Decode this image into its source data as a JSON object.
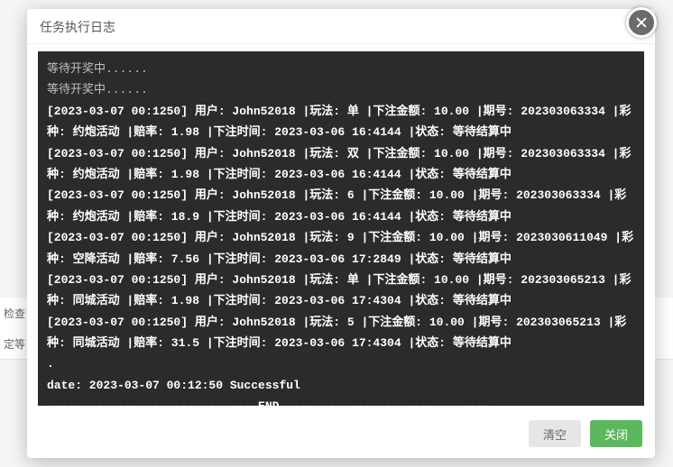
{
  "background_rows": [
    "检查",
    "定等"
  ],
  "modal": {
    "title": "任务执行日志",
    "clear_label": "清空",
    "close_label": "关闭"
  },
  "log": {
    "pre_lines": [
      "等待开奖中......",
      "等待开奖中......"
    ],
    "entries": [
      {
        "ts": "2023-03-07 00:1250",
        "user": "John52018",
        "play": "单",
        "amount": "10.00",
        "period": "202303063334",
        "lottery": "约炮活动",
        "odds": "1.98",
        "bet_time": "2023-03-06 16:4144",
        "status": "等待结算中"
      },
      {
        "ts": "2023-03-07 00:1250",
        "user": "John52018",
        "play": "双",
        "amount": "10.00",
        "period": "202303063334",
        "lottery": "约炮活动",
        "odds": "1.98",
        "bet_time": "2023-03-06 16:4144",
        "status": "等待结算中"
      },
      {
        "ts": "2023-03-07 00:1250",
        "user": "John52018",
        "play": "6",
        "amount": "10.00",
        "period": "202303063334",
        "lottery": "约炮活动",
        "odds": "18.9",
        "bet_time": "2023-03-06 16:4144",
        "status": "等待结算中"
      },
      {
        "ts": "2023-03-07 00:1250",
        "user": "John52018",
        "play": "9",
        "amount": "10.00",
        "period": "2023030611049",
        "lottery": "空降活动",
        "odds": "7.56",
        "bet_time": "2023-03-06 17:2849",
        "status": "等待结算中"
      },
      {
        "ts": "2023-03-07 00:1250",
        "user": "John52018",
        "play": "单",
        "amount": "10.00",
        "period": "202303065213",
        "lottery": "同城活动",
        "odds": "1.98",
        "bet_time": "2023-03-06 17:4304",
        "status": "等待结算中"
      },
      {
        "ts": "2023-03-07 00:1250",
        "user": "John52018",
        "play": "5",
        "amount": "10.00",
        "period": "202303065213",
        "lottery": "同城活动",
        "odds": "31.5",
        "bet_time": "2023-03-06 17:4304",
        "status": "等待结算中"
      }
    ],
    "labels": {
      "user": "用户",
      "play": "玩法",
      "amount": "下注金额",
      "period": "期号",
      "lottery": "彩种",
      "odds": "赔率",
      "bet_time": "下注时间",
      "status": "状态"
    },
    "tail_dot": ".",
    "success_line": "date: 2023-03-07 00:12:50 Successful",
    "end_line": "------------------------------END------------------------------"
  }
}
